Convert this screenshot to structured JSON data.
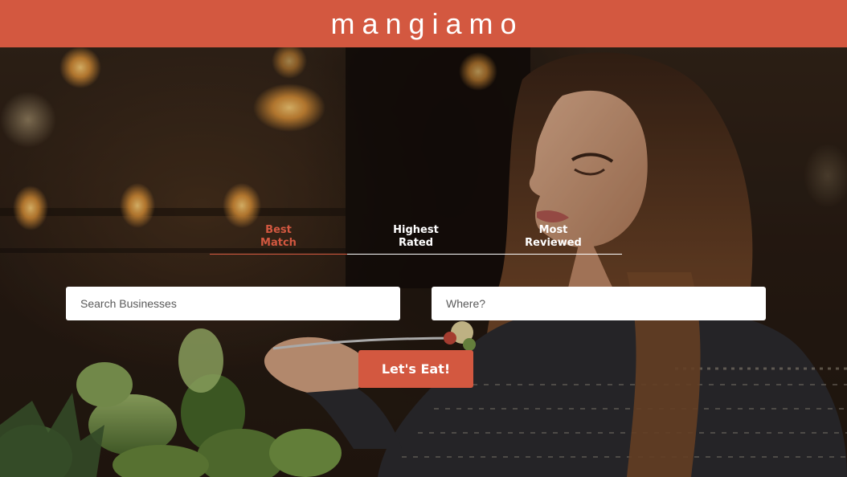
{
  "header": {
    "logo_text": "mangiamo"
  },
  "hero": {
    "image": "photo of a woman with long hair tasting food from a fork in a warmly lit restaurant"
  },
  "sort_tabs": [
    {
      "label": "Best Match",
      "active": true
    },
    {
      "label": "Highest Rated",
      "active": false
    },
    {
      "label": "Most Reviewed",
      "active": false
    }
  ],
  "search": {
    "business_placeholder": "Search Businesses",
    "business_value": "",
    "location_placeholder": "Where?",
    "location_value": ""
  },
  "submit": {
    "label": "Let's Eat!"
  },
  "colors": {
    "brand": "#d35840",
    "text_on_brand": "#ffffff",
    "input_bg": "#ffffff"
  }
}
